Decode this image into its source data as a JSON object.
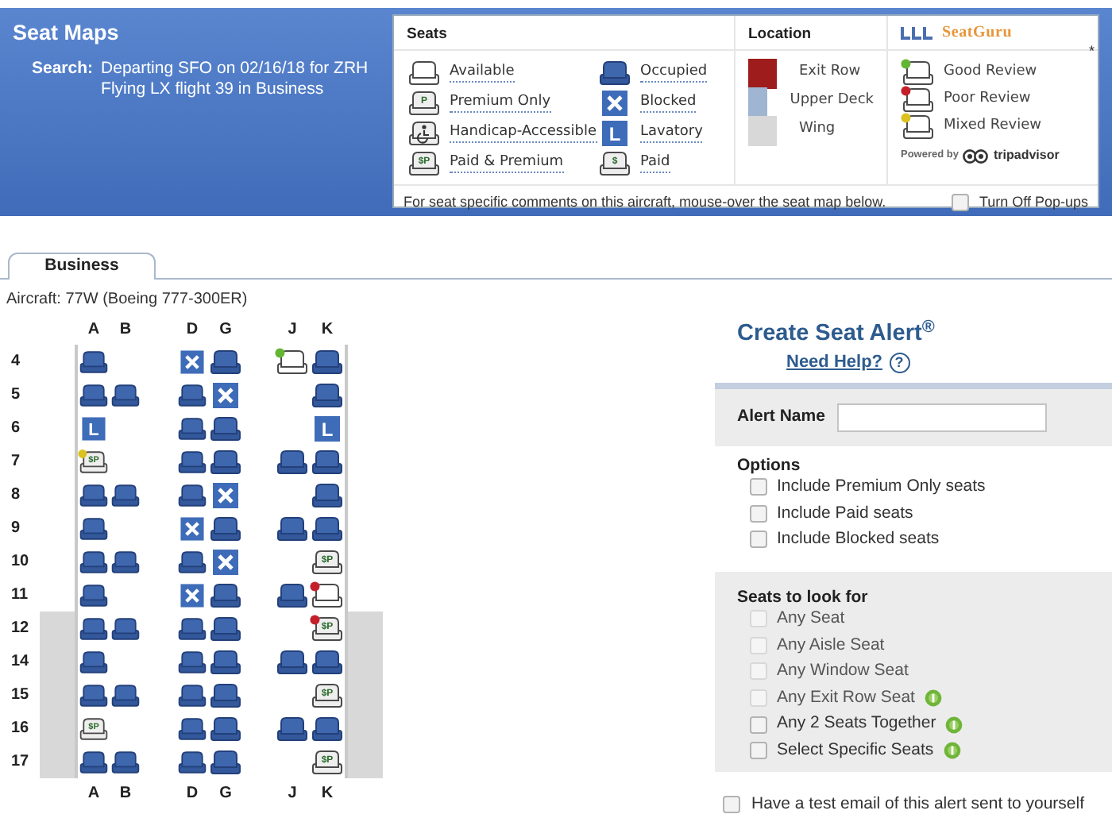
{
  "header": {
    "title": "Seat Maps",
    "search_label": "Search:",
    "search_lines": [
      "Departing SFO on 02/16/18 for ZRH",
      "Flying LX flight 39 in Business"
    ]
  },
  "legend": {
    "seats_heading": "Seats",
    "seat_items": [
      {
        "kind": "available",
        "label": "Available"
      },
      {
        "kind": "occupied",
        "label": "Occupied"
      },
      {
        "kind": "premium",
        "glyph": "P",
        "label": "Premium Only"
      },
      {
        "kind": "blocked",
        "label": "Blocked"
      },
      {
        "kind": "handicap",
        "label": "Handicap-Accessible"
      },
      {
        "kind": "lavatory",
        "glyph": "L",
        "label": "Lavatory"
      },
      {
        "kind": "paid_premium",
        "glyph": "$P",
        "label": "Paid & Premium"
      },
      {
        "kind": "paid",
        "glyph": "$",
        "label": "Paid"
      }
    ],
    "location_heading": "Location",
    "locations": [
      {
        "label": "Exit Row",
        "color": "#9e1c1c"
      },
      {
        "label": "Upper Deck",
        "color": "#9fb5d1"
      },
      {
        "label": "Wing",
        "color": "#d8d8d8"
      }
    ],
    "brand": "SeatGuru",
    "asterisk": "*",
    "reviews": [
      {
        "label": "Good Review",
        "color": "#63b532"
      },
      {
        "label": "Poor Review",
        "color": "#c3202a"
      },
      {
        "label": "Mixed Review",
        "color": "#dcc21e"
      }
    ],
    "powered_by": "Powered by",
    "tripadvisor": "tripadvisor",
    "note": "For seat specific comments on this aircraft, mouse-over the seat map below.",
    "popups": {
      "label": "Turn Off Pop-ups",
      "checked": false
    }
  },
  "tabs": [
    {
      "label": "Business",
      "selected": true
    }
  ],
  "aircraft": "Aircraft: 77W (Boeing 777-300ER)",
  "seat_map": {
    "columns_top": [
      "A",
      "B",
      "D",
      "G",
      "J",
      "K"
    ],
    "columns_bottom": [
      "A",
      "B",
      "D",
      "G",
      "J",
      "K"
    ],
    "rows": [
      {
        "label": "4",
        "wing": false,
        "seats": {
          "a": {
            "kind": "occupied"
          },
          "d": {
            "kind": "blocked"
          },
          "g": {
            "kind": "occupied"
          },
          "j": {
            "kind": "available",
            "color": "#63b532"
          },
          "k": {
            "kind": "occupied"
          }
        }
      },
      {
        "label": "5",
        "wing": false,
        "seats": {
          "a": {
            "kind": "occupied"
          },
          "b": {
            "kind": "occupied"
          },
          "d": {
            "kind": "occupied"
          },
          "g": {
            "kind": "blocked"
          },
          "k": {
            "kind": "occupied"
          }
        }
      },
      {
        "label": "6",
        "wing": false,
        "seats": {
          "a": {
            "kind": "lavatory",
            "glyph": "L"
          },
          "d": {
            "kind": "occupied"
          },
          "g": {
            "kind": "occupied"
          },
          "k": {
            "kind": "lavatory",
            "glyph": "L"
          }
        }
      },
      {
        "label": "7",
        "wing": false,
        "seats": {
          "a": {
            "kind": "paid_premium",
            "glyph": "$P",
            "color": "#dcc21e"
          },
          "d": {
            "kind": "occupied"
          },
          "g": {
            "kind": "occupied"
          },
          "j": {
            "kind": "occupied"
          },
          "k": {
            "kind": "occupied"
          }
        }
      },
      {
        "label": "8",
        "wing": false,
        "seats": {
          "a": {
            "kind": "occupied"
          },
          "b": {
            "kind": "occupied"
          },
          "d": {
            "kind": "occupied"
          },
          "g": {
            "kind": "blocked"
          },
          "k": {
            "kind": "occupied"
          }
        }
      },
      {
        "label": "9",
        "wing": false,
        "seats": {
          "a": {
            "kind": "occupied"
          },
          "d": {
            "kind": "blocked"
          },
          "g": {
            "kind": "occupied"
          },
          "j": {
            "kind": "occupied"
          },
          "k": {
            "kind": "occupied"
          }
        }
      },
      {
        "label": "10",
        "wing": false,
        "seats": {
          "a": {
            "kind": "occupied"
          },
          "b": {
            "kind": "occupied"
          },
          "d": {
            "kind": "occupied"
          },
          "g": {
            "kind": "blocked"
          },
          "k": {
            "kind": "paid_premium",
            "glyph": "$P"
          }
        }
      },
      {
        "label": "11",
        "wing": false,
        "seats": {
          "a": {
            "kind": "occupied"
          },
          "d": {
            "kind": "blocked"
          },
          "g": {
            "kind": "occupied"
          },
          "j": {
            "kind": "occupied"
          },
          "k": {
            "kind": "available",
            "color": "#c3202a"
          }
        }
      },
      {
        "label": "12",
        "wing": true,
        "seats": {
          "a": {
            "kind": "occupied"
          },
          "b": {
            "kind": "occupied"
          },
          "d": {
            "kind": "occupied"
          },
          "g": {
            "kind": "occupied"
          },
          "k": {
            "kind": "paid_premium",
            "glyph": "$P",
            "color": "#c3202a"
          }
        }
      },
      {
        "label": "14",
        "wing": true,
        "seats": {
          "a": {
            "kind": "occupied"
          },
          "d": {
            "kind": "occupied"
          },
          "g": {
            "kind": "occupied"
          },
          "j": {
            "kind": "occupied"
          },
          "k": {
            "kind": "occupied"
          }
        }
      },
      {
        "label": "15",
        "wing": true,
        "seats": {
          "a": {
            "kind": "occupied"
          },
          "b": {
            "kind": "occupied"
          },
          "d": {
            "kind": "occupied"
          },
          "g": {
            "kind": "occupied"
          },
          "k": {
            "kind": "paid_premium",
            "glyph": "$P"
          }
        }
      },
      {
        "label": "16",
        "wing": true,
        "seats": {
          "a": {
            "kind": "paid_premium",
            "glyph": "$P"
          },
          "d": {
            "kind": "occupied"
          },
          "g": {
            "kind": "occupied"
          },
          "j": {
            "kind": "occupied"
          },
          "k": {
            "kind": "occupied"
          }
        }
      },
      {
        "label": "17",
        "wing": true,
        "seats": {
          "a": {
            "kind": "occupied"
          },
          "b": {
            "kind": "occupied"
          },
          "d": {
            "kind": "occupied"
          },
          "g": {
            "kind": "occupied"
          },
          "k": {
            "kind": "paid_premium",
            "glyph": "$P"
          }
        }
      }
    ]
  },
  "alert": {
    "title": "Create Seat Alert$^{®}$",
    "help": "Need Help?",
    "help_icon": "?",
    "name_label": "Alert Name",
    "options_heading": "Options",
    "options": [
      {
        "label": "Include Premium Only seats",
        "checked": false
      },
      {
        "label": "Include Paid seats",
        "checked": false
      },
      {
        "label": "Include Blocked seats",
        "checked": false
      }
    ],
    "seats_heading": "Seats to look for",
    "seat_options": [
      {
        "label": "Any Seat",
        "checked": false,
        "disabled": true,
        "paid": false
      },
      {
        "label": "Any Aisle Seat",
        "checked": false,
        "disabled": true,
        "paid": false
      },
      {
        "label": "Any Window Seat",
        "checked": false,
        "disabled": true,
        "paid": false
      },
      {
        "label": "Any Exit Row Seat",
        "checked": false,
        "disabled": true,
        "paid": true
      },
      {
        "label": "Any 2 Seats Together",
        "checked": false,
        "disabled": false,
        "paid": true
      },
      {
        "label": "Select Specific Seats",
        "checked": false,
        "disabled": false,
        "paid": true
      }
    ],
    "test_email": {
      "label": "Have a test email of this alert sent to yourself",
      "checked": false
    }
  }
}
